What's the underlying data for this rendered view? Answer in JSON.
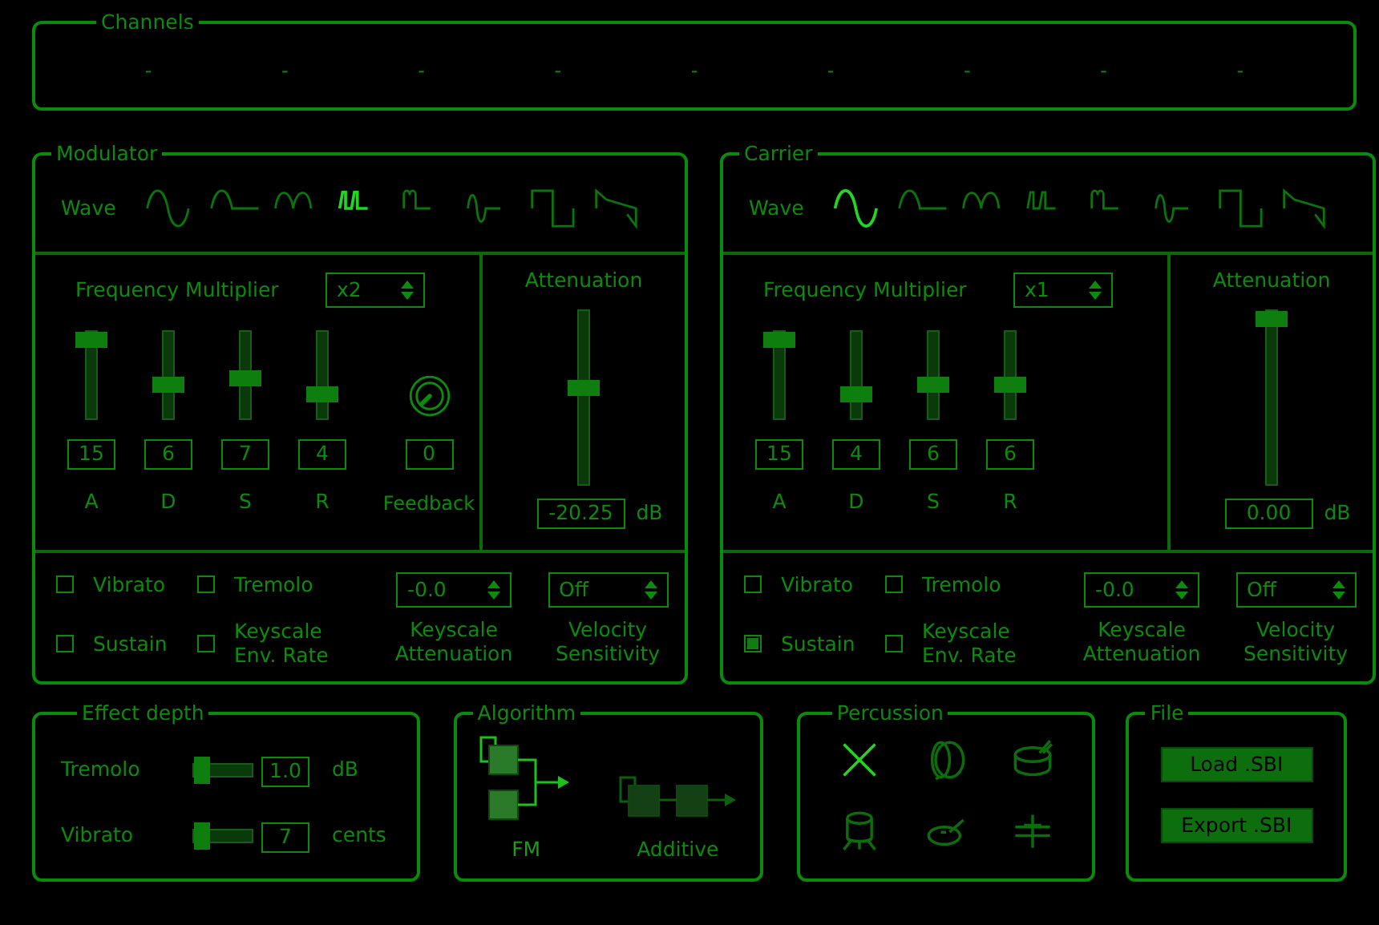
{
  "channels": {
    "title": "Channels",
    "items": [
      "-",
      "-",
      "-",
      "-",
      "-",
      "-",
      "-",
      "-",
      "-"
    ]
  },
  "modulator": {
    "title": "Modulator",
    "wave_label": "Wave",
    "waves": [
      {
        "selected": false
      },
      {
        "selected": false
      },
      {
        "selected": false
      },
      {
        "selected": true
      },
      {
        "selected": false
      },
      {
        "selected": false
      },
      {
        "selected": false
      },
      {
        "selected": false
      }
    ],
    "frequency_multiplier": {
      "label": "Frequency Multiplier",
      "value": "x2"
    },
    "envelope": [
      {
        "label": "A",
        "value": "15",
        "level": 1
      },
      {
        "label": "D",
        "value": "6",
        "level": 0.4
      },
      {
        "label": "S",
        "value": "7",
        "level": 0.47
      },
      {
        "label": "R",
        "value": "4",
        "level": 0.27
      }
    ],
    "feedback": {
      "label": "Feedback",
      "value": "0"
    },
    "attenuation": {
      "label": "Attenuation",
      "value": "-20.25",
      "unit": "dB",
      "level": 0.57
    },
    "options": [
      {
        "label": "Vibrato",
        "checked": false
      },
      {
        "label": "Sustain",
        "checked": false
      },
      {
        "label": "Tremolo",
        "checked": false
      },
      {
        "label": "Keyscale Env. Rate",
        "checked": false
      }
    ],
    "keyscale_attenuation": {
      "label": "Keyscale Attenuation",
      "value": "-0.0"
    },
    "velocity_sensitivity": {
      "label": "Velocity Sensitivity",
      "value": "Off"
    }
  },
  "carrier": {
    "title": "Carrier",
    "wave_label": "Wave",
    "waves": [
      {
        "selected": true
      },
      {
        "selected": false
      },
      {
        "selected": false
      },
      {
        "selected": false
      },
      {
        "selected": false
      },
      {
        "selected": false
      },
      {
        "selected": false
      },
      {
        "selected": false
      }
    ],
    "frequency_multiplier": {
      "label": "Frequency Multiplier",
      "value": "x1"
    },
    "envelope": [
      {
        "label": "A",
        "value": "15",
        "level": 1
      },
      {
        "label": "D",
        "value": "4",
        "level": 0.27
      },
      {
        "label": "S",
        "value": "6",
        "level": 0.4
      },
      {
        "label": "R",
        "value": "6",
        "level": 0.4
      }
    ],
    "attenuation": {
      "label": "Attenuation",
      "value": "0.00",
      "unit": "dB",
      "level": 1
    },
    "options": [
      {
        "label": "Vibrato",
        "checked": false
      },
      {
        "label": "Sustain",
        "checked": true
      },
      {
        "label": "Tremolo",
        "checked": false
      },
      {
        "label": "Keyscale Env. Rate",
        "checked": false
      }
    ],
    "keyscale_attenuation": {
      "label": "Keyscale Attenuation",
      "value": "-0.0"
    },
    "velocity_sensitivity": {
      "label": "Velocity Sensitivity",
      "value": "Off"
    }
  },
  "effect_depth": {
    "title": "Effect depth",
    "rows": [
      {
        "label": "Tremolo",
        "value": "1.0",
        "unit": "dB",
        "level": 0
      },
      {
        "label": "Vibrato",
        "value": "7",
        "unit": "cents",
        "level": 0
      }
    ]
  },
  "algorithm": {
    "title": "Algorithm",
    "options": [
      {
        "kind": "fm",
        "label": "FM",
        "selected": true
      },
      {
        "kind": "additive",
        "label": "Additive",
        "selected": false
      }
    ]
  },
  "percussion": {
    "title": "Percussion",
    "items": [
      {
        "kind": "off",
        "selected": true
      },
      {
        "kind": "bass_drum",
        "selected": false
      },
      {
        "kind": "snare",
        "selected": false
      },
      {
        "kind": "tom",
        "selected": false
      },
      {
        "kind": "cymbal",
        "selected": false
      },
      {
        "kind": "hihat",
        "selected": false
      }
    ]
  },
  "file": {
    "title": "File",
    "buttons": [
      "Load .SBI",
      "Export .SBI"
    ]
  }
}
